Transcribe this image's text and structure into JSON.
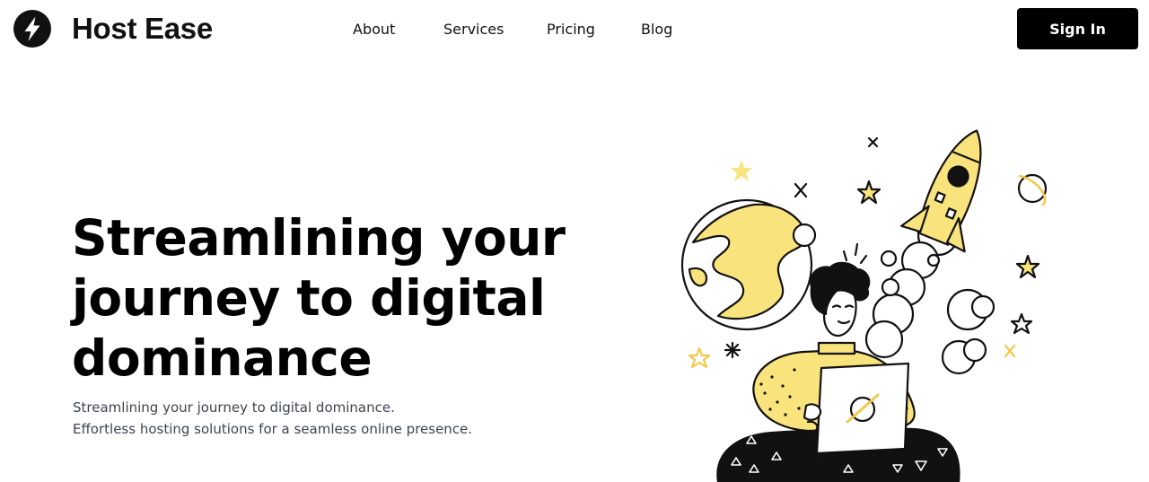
{
  "brand": {
    "name": "Host Ease",
    "logo_icon": "lightning-bolt-icon"
  },
  "nav": {
    "items": [
      {
        "label": "About"
      },
      {
        "label": "Services"
      },
      {
        "label": "Pricing"
      },
      {
        "label": "Blog"
      }
    ]
  },
  "header": {
    "signin_label": "Sign In"
  },
  "hero": {
    "title_lines": [
      "Streamlining your",
      "journey to digital",
      "dominance"
    ],
    "subtitle_lines": [
      "Streamlining your journey to digital dominance.",
      "Effortless hosting solutions for a seamless online presence."
    ],
    "illustration": "person-with-laptop-and-rocket-illustration"
  },
  "colors": {
    "accent_yellow": "#f9e37c",
    "primary_black": "#000000",
    "subtitle_gray": "#3d4451"
  }
}
